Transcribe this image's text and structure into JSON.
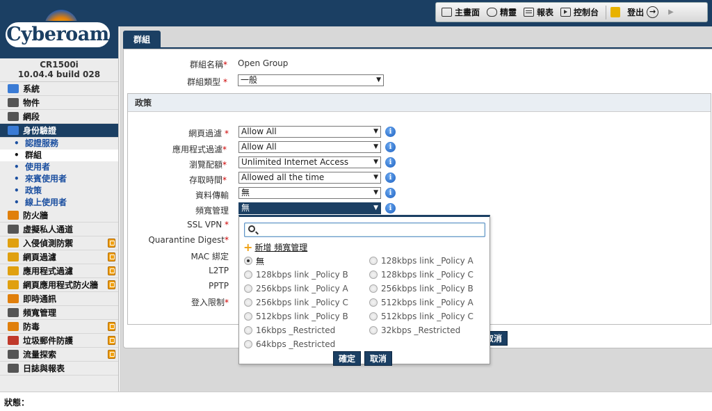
{
  "toolbar": {
    "dashboard": "主畫面",
    "wizard": "精靈",
    "reports": "報表",
    "console": "控制台",
    "logout": "登出"
  },
  "sidebar": {
    "logo_text": "Cyberoam",
    "device_model": "CR1500i",
    "device_version": "10.04.4 build 028",
    "items": [
      {
        "label": "系統",
        "color": "#3a7bd5"
      },
      {
        "label": "物件",
        "color": "#555555"
      },
      {
        "label": "網段",
        "color": "#555555"
      },
      {
        "label": "身份驗證",
        "color": "#3a7bd5"
      }
    ],
    "subitems": [
      "認證服務",
      "群組",
      "使用者",
      "來賓使用者",
      "政策",
      "線上使用者"
    ],
    "items_bottom": [
      {
        "label": "防火牆",
        "color": "#e07f0c"
      },
      {
        "label": "虛擬私人通道",
        "color": "#555555"
      },
      {
        "label": "入侵偵測防禦",
        "color": "#e0a010"
      },
      {
        "label": "網頁過濾",
        "color": "#e0a010"
      },
      {
        "label": "應用程式過濾",
        "color": "#e0a010"
      },
      {
        "label": "網頁應用程式防火牆",
        "color": "#e0a010"
      },
      {
        "label": "即時通訊",
        "color": "#e07f0c"
      },
      {
        "label": "頻寬管理",
        "color": "#555555"
      },
      {
        "label": "防毒",
        "color": "#e07f0c"
      },
      {
        "label": "垃圾郵件防護",
        "color": "#c0392b"
      },
      {
        "label": "流量探索",
        "color": "#555555"
      },
      {
        "label": "日誌與報表",
        "color": "#555555"
      }
    ]
  },
  "tab": {
    "label": "群組"
  },
  "form": {
    "group_name_label": "群組名稱",
    "group_name_value": "Open Group",
    "group_type_label": "群組類型",
    "group_type_value": "一般",
    "policy_section": "政策",
    "web_filter_label": "網頁過濾",
    "web_filter_value": "Allow All",
    "app_filter_label": "應用程式過濾",
    "app_filter_value": "Allow All",
    "surfing_quota_label": "瀏覽配額",
    "surfing_quota_value": "Unlimited Internet Access",
    "access_time_label": "存取時間",
    "access_time_value": "Allowed all the time",
    "data_transfer_label": "資料傳輸",
    "data_transfer_value": "無",
    "bandwidth_label": "頻寬管理",
    "bandwidth_value": "無",
    "ssl_vpn_label": "SSL VPN",
    "quarantine_label": "Quarantine Digest",
    "mac_label": "MAC 綁定",
    "l2tp_label": "L2TP",
    "pptp_label": "PPTP",
    "login_limit_label": "登入限制",
    "cancel_label": "取消"
  },
  "dropdown": {
    "search_placeholder": "",
    "add_new": "新增 頻寬管理",
    "options_left": [
      "無",
      "128kbps link _Policy B",
      "256kbps link _Policy A",
      "256kbps link _Policy C",
      "512kbps link _Policy B",
      "16kbps _Restricted",
      "64kbps _Restricted"
    ],
    "options_right": [
      "128kbps link _Policy A",
      "128kbps link _Policy C",
      "256kbps link _Policy B",
      "512kbps link _Policy A",
      "512kbps link _Policy C",
      "32kbps _Restricted"
    ],
    "selected": "無",
    "ok_label": "確定",
    "cancel_label": "取消"
  },
  "status": {
    "label": "狀態："
  },
  "colors": {
    "brand": "#1b3f63",
    "required": "#cc0000",
    "badge": "#f0a010"
  }
}
